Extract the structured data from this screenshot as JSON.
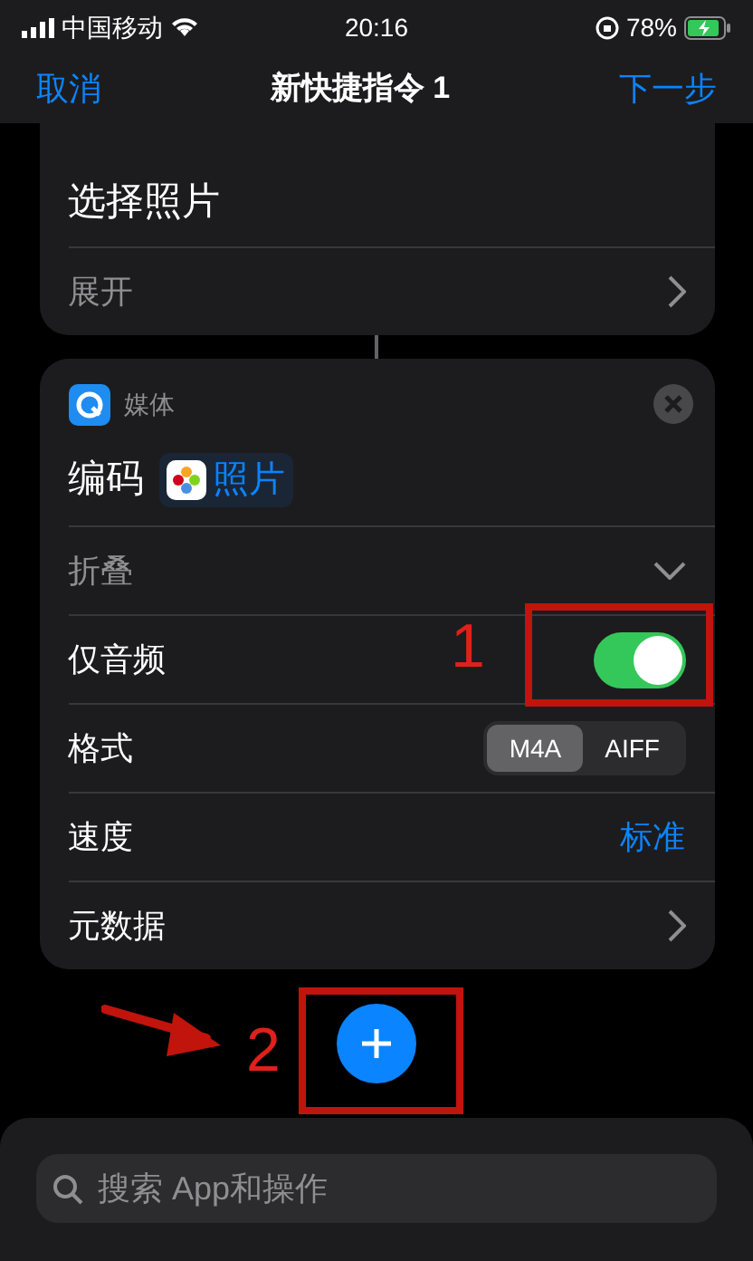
{
  "status_bar": {
    "carrier": "中国移动",
    "time": "20:16",
    "battery": "78%"
  },
  "nav": {
    "cancel": "取消",
    "title": "新快捷指令 1",
    "next": "下一步"
  },
  "cards": [
    {
      "action": "选择照片",
      "rows": [
        {
          "kind": "disclosure",
          "label": "展开"
        }
      ]
    },
    {
      "category": "媒体",
      "action": "编码",
      "variable": "照片",
      "rows": [
        {
          "kind": "collapse",
          "label": "折叠"
        },
        {
          "kind": "toggle",
          "label": "仅音频",
          "on": true
        },
        {
          "kind": "segmented",
          "label": "格式",
          "options": [
            {
              "label": "M4A",
              "selected": true
            },
            {
              "label": "AIFF",
              "selected": false
            }
          ]
        },
        {
          "kind": "value",
          "label": "速度",
          "value": "标准"
        },
        {
          "kind": "disclosure",
          "label": "元数据"
        }
      ]
    }
  ],
  "annotations": [
    {
      "label": "1"
    },
    {
      "label": "2"
    }
  ],
  "search": {
    "placeholder": "搜索 App和操作"
  }
}
